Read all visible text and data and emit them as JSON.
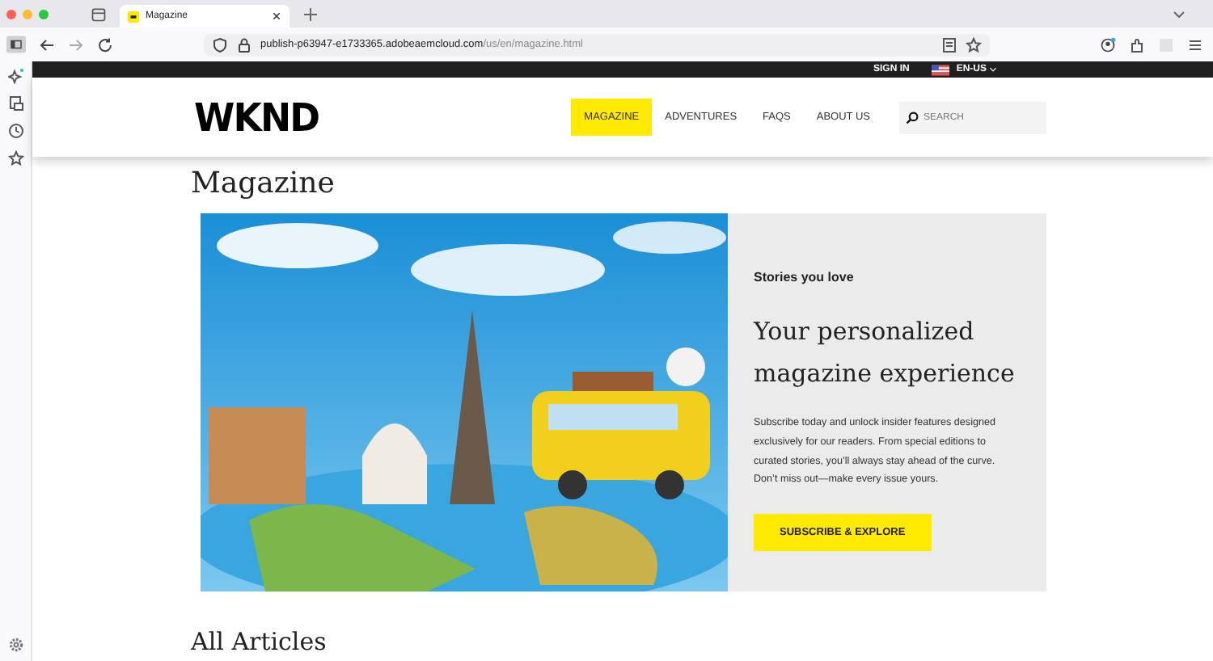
{
  "browser": {
    "tabs": [
      {
        "title": "Magazine",
        "selected": true
      }
    ],
    "url_host": "publish-p63947-e1733365.adobeaemcloud.com",
    "url_path": "/us/en/magazine.html"
  },
  "utility_bar": {
    "sign_in": "SIGN IN",
    "language": "EN-US"
  },
  "header": {
    "logo": "WKND",
    "nav": [
      {
        "label": "MAGAZINE",
        "selected": true
      },
      {
        "label": "ADVENTURES",
        "selected": false
      },
      {
        "label": "FAQS",
        "selected": false
      },
      {
        "label": "ABOUT US",
        "selected": false
      }
    ],
    "search": {
      "placeholder": "SEARCH"
    }
  },
  "page_title": "Magazine",
  "hero": {
    "eyebrow": "Stories you love",
    "title": "Your personalized magazine experience",
    "body": "Subscribe today and unlock insider features designed exclusively for our readers. From special editions to curated stories, you’ll always stay ahead of the curve. Don’t miss out—make every issue yours.",
    "button": "SUBSCRIBE & EXPLORE"
  },
  "section_title": "All Articles"
}
